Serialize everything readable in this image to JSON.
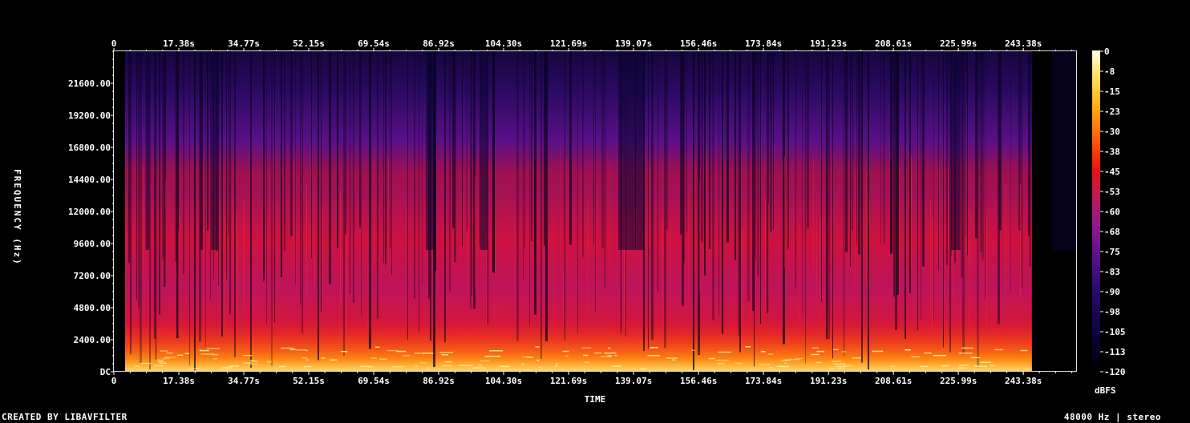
{
  "chart_data": {
    "type": "heatmap",
    "title": "",
    "xlabel": "TIME",
    "ylabel": "FREQUENCY (Hz)",
    "x_ticks": [
      "0",
      "17.38s",
      "34.77s",
      "52.15s",
      "69.54s",
      "86.92s",
      "104.30s",
      "121.69s",
      "139.07s",
      "156.46s",
      "173.84s",
      "191.23s",
      "208.61s",
      "225.99s",
      "243.38s"
    ],
    "y_ticks": [
      "DC",
      "2400.00",
      "4800.00",
      "7200.00",
      "9600.00",
      "12000.00",
      "14400.00",
      "16800.00",
      "19200.00",
      "21600.00"
    ],
    "x_range_s": [
      0,
      257.5
    ],
    "y_range_hz": [
      0,
      24000
    ],
    "colorbar": {
      "label": "dBFS",
      "ticks": [
        "0",
        "-8",
        "-15",
        "-23",
        "-30",
        "-38",
        "-45",
        "-53",
        "-60",
        "-68",
        "-75",
        "-83",
        "-90",
        "-98",
        "-105",
        "-113",
        "-120"
      ],
      "range": [
        -120,
        0
      ]
    },
    "grid": false
  },
  "footer": {
    "left": "CREATED BY LIBAVFILTER",
    "right": "48000 Hz | stereo"
  },
  "palette": {
    "spectrum": [
      "#000000",
      "#0c0440",
      "#2a0a66",
      "#55108a",
      "#8a1a8e",
      "#c21a55",
      "#e81414",
      "#ff5a0a",
      "#ffaa10",
      "#ffe060",
      "#ffffe6"
    ]
  }
}
